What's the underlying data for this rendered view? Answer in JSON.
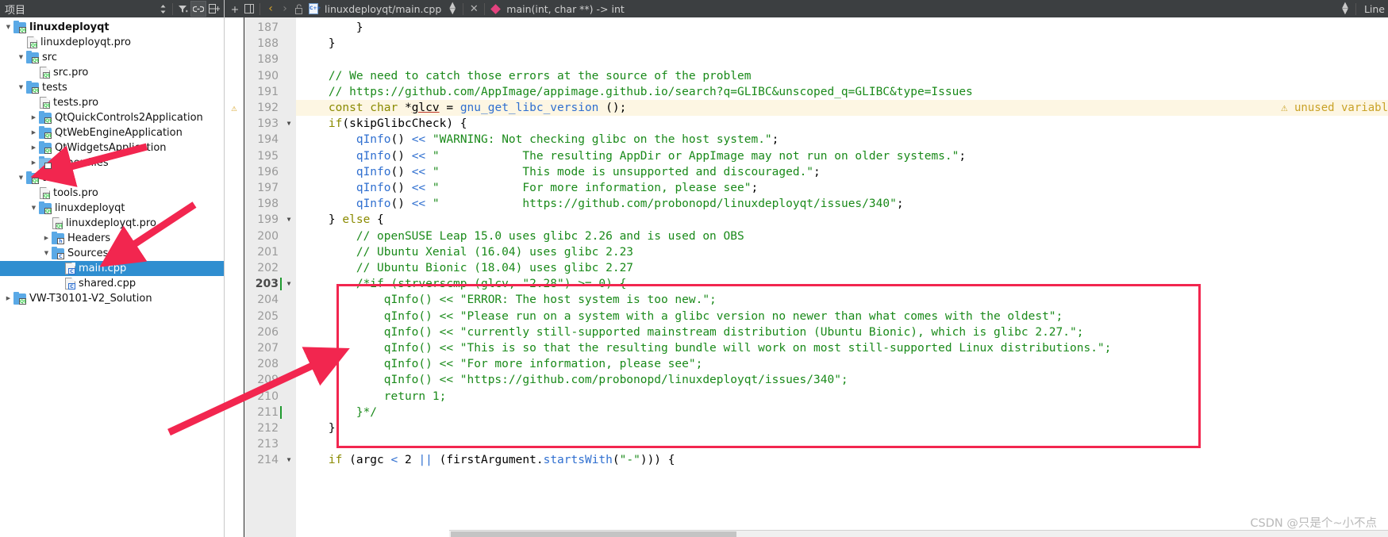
{
  "sidebar": {
    "title": "项目",
    "header_icons": [
      "sort-icon",
      "filter-icon",
      "link-icon",
      "split-icon"
    ],
    "tree": [
      {
        "depth": 0,
        "arrow": "down",
        "icon": "folder-qt",
        "label": "linuxdeployqt",
        "bold": true,
        "selected": false
      },
      {
        "depth": 1,
        "arrow": "none",
        "icon": "file-pro",
        "label": "linuxdeployqt.pro",
        "bold": false,
        "selected": false
      },
      {
        "depth": 1,
        "arrow": "down",
        "icon": "folder-qt",
        "label": "src",
        "bold": false,
        "selected": false
      },
      {
        "depth": 2,
        "arrow": "none",
        "icon": "file-pro",
        "label": "src.pro",
        "bold": false,
        "selected": false
      },
      {
        "depth": 1,
        "arrow": "down",
        "icon": "folder-qt",
        "label": "tests",
        "bold": false,
        "selected": false
      },
      {
        "depth": 2,
        "arrow": "none",
        "icon": "file-pro",
        "label": "tests.pro",
        "bold": false,
        "selected": false
      },
      {
        "depth": 2,
        "arrow": "right",
        "icon": "folder-qt",
        "label": "QtQuickControls2Application",
        "bold": false,
        "selected": false
      },
      {
        "depth": 2,
        "arrow": "right",
        "icon": "folder-qt",
        "label": "QtWebEngineApplication",
        "bold": false,
        "selected": false
      },
      {
        "depth": 2,
        "arrow": "right",
        "icon": "folder-qt",
        "label": "QtWidgetsApplication",
        "bold": false,
        "selected": false
      },
      {
        "depth": 2,
        "arrow": "right",
        "icon": "folder-other",
        "label": "Other files",
        "bold": false,
        "selected": false
      },
      {
        "depth": 1,
        "arrow": "down",
        "icon": "folder-qt",
        "label": "tools",
        "bold": false,
        "selected": false
      },
      {
        "depth": 2,
        "arrow": "none",
        "icon": "file-pro",
        "label": "tools.pro",
        "bold": false,
        "selected": false
      },
      {
        "depth": 2,
        "arrow": "down",
        "icon": "folder-qt",
        "label": "linuxdeployqt",
        "bold": false,
        "selected": false
      },
      {
        "depth": 3,
        "arrow": "none",
        "icon": "file-pro",
        "label": "linuxdeployqt.pro",
        "bold": false,
        "selected": false
      },
      {
        "depth": 3,
        "arrow": "right",
        "icon": "folder-h",
        "label": "Headers",
        "bold": false,
        "selected": false
      },
      {
        "depth": 3,
        "arrow": "down",
        "icon": "folder-cpp",
        "label": "Sources",
        "bold": false,
        "selected": false
      },
      {
        "depth": 4,
        "arrow": "none",
        "icon": "file-cpp",
        "label": "main.cpp",
        "bold": false,
        "selected": true
      },
      {
        "depth": 4,
        "arrow": "none",
        "icon": "file-cpp",
        "label": "shared.cpp",
        "bold": false,
        "selected": false
      },
      {
        "depth": 0,
        "arrow": "right",
        "icon": "folder-qt",
        "label": "VW-T30101-V2_Solution",
        "bold": false,
        "selected": false
      }
    ]
  },
  "tabbar": {
    "back_arrow": "‹",
    "forward_arrow": "›",
    "lock_icon": "unlocked-padlock-icon",
    "file_icon": "cpp-file-icon",
    "file_path": "linuxdeployqt/main.cpp",
    "dropdown_icon": "updown-chevron-icon",
    "close_icon": "close-icon",
    "symbol_icon": "function-diamond-icon",
    "symbol": "main(int, char **) -> int",
    "right_dropdown_icon": "updown-chevron-icon",
    "line_label": "Line"
  },
  "editor": {
    "warning_annotation": "⚠ unused variabl",
    "lines": [
      {
        "num": "187",
        "fold": "",
        "warn": false,
        "cursor": false,
        "tokens": [
          {
            "t": "        }",
            "c": "pl"
          }
        ]
      },
      {
        "num": "188",
        "fold": "",
        "warn": false,
        "cursor": false,
        "tokens": [
          {
            "t": "    }",
            "c": "pl"
          }
        ]
      },
      {
        "num": "189",
        "fold": "",
        "warn": false,
        "cursor": false,
        "tokens": [
          {
            "t": "",
            "c": "pl"
          }
        ]
      },
      {
        "num": "190",
        "fold": "",
        "warn": false,
        "cursor": false,
        "tokens": [
          {
            "t": "    // We need to catch those errors at the source of the problem",
            "c": "cm"
          }
        ]
      },
      {
        "num": "191",
        "fold": "",
        "warn": false,
        "cursor": false,
        "tokens": [
          {
            "t": "    // https://github.com/AppImage/appimage.github.io/search?q=GLIBC&unscoped_q=GLIBC&type=Issues",
            "c": "cm"
          }
        ]
      },
      {
        "num": "192",
        "fold": "",
        "warn": true,
        "cursor": false,
        "highlight": true,
        "tokens": [
          {
            "t": "    ",
            "c": "pl"
          },
          {
            "t": "const char ",
            "c": "kw"
          },
          {
            "t": "*",
            "c": "pl"
          },
          {
            "t": "glcv",
            "c": "err"
          },
          {
            "t": " = ",
            "c": "pl"
          },
          {
            "t": "gnu_get_libc_version",
            "c": "fn"
          },
          {
            "t": " ();",
            "c": "pl"
          }
        ]
      },
      {
        "num": "193",
        "fold": "down",
        "warn": false,
        "cursor": false,
        "tokens": [
          {
            "t": "    ",
            "c": "pl"
          },
          {
            "t": "if",
            "c": "kw"
          },
          {
            "t": "(skipGlibcCheck) {",
            "c": "pl"
          }
        ]
      },
      {
        "num": "194",
        "fold": "",
        "warn": false,
        "cursor": false,
        "tokens": [
          {
            "t": "        ",
            "c": "pl"
          },
          {
            "t": "qInfo",
            "c": "fn"
          },
          {
            "t": "() ",
            "c": "pl"
          },
          {
            "t": "<<",
            "c": "fn"
          },
          {
            "t": " ",
            "c": "pl"
          },
          {
            "t": "\"WARNING: Not checking glibc on the host system.\"",
            "c": "str"
          },
          {
            "t": ";",
            "c": "pl"
          }
        ]
      },
      {
        "num": "195",
        "fold": "",
        "warn": false,
        "cursor": false,
        "tokens": [
          {
            "t": "        ",
            "c": "pl"
          },
          {
            "t": "qInfo",
            "c": "fn"
          },
          {
            "t": "() ",
            "c": "pl"
          },
          {
            "t": "<<",
            "c": "fn"
          },
          {
            "t": " ",
            "c": "pl"
          },
          {
            "t": "\"            The resulting AppDir or AppImage may not run on older systems.\"",
            "c": "str"
          },
          {
            "t": ";",
            "c": "pl"
          }
        ]
      },
      {
        "num": "196",
        "fold": "",
        "warn": false,
        "cursor": false,
        "tokens": [
          {
            "t": "        ",
            "c": "pl"
          },
          {
            "t": "qInfo",
            "c": "fn"
          },
          {
            "t": "() ",
            "c": "pl"
          },
          {
            "t": "<<",
            "c": "fn"
          },
          {
            "t": " ",
            "c": "pl"
          },
          {
            "t": "\"            This mode is unsupported and discouraged.\"",
            "c": "str"
          },
          {
            "t": ";",
            "c": "pl"
          }
        ]
      },
      {
        "num": "197",
        "fold": "",
        "warn": false,
        "cursor": false,
        "tokens": [
          {
            "t": "        ",
            "c": "pl"
          },
          {
            "t": "qInfo",
            "c": "fn"
          },
          {
            "t": "() ",
            "c": "pl"
          },
          {
            "t": "<<",
            "c": "fn"
          },
          {
            "t": " ",
            "c": "pl"
          },
          {
            "t": "\"            For more information, please see\"",
            "c": "str"
          },
          {
            "t": ";",
            "c": "pl"
          }
        ]
      },
      {
        "num": "198",
        "fold": "",
        "warn": false,
        "cursor": false,
        "tokens": [
          {
            "t": "        ",
            "c": "pl"
          },
          {
            "t": "qInfo",
            "c": "fn"
          },
          {
            "t": "() ",
            "c": "pl"
          },
          {
            "t": "<<",
            "c": "fn"
          },
          {
            "t": " ",
            "c": "pl"
          },
          {
            "t": "\"            https://github.com/probonopd/linuxdeployqt/issues/340\"",
            "c": "str"
          },
          {
            "t": ";",
            "c": "pl"
          }
        ]
      },
      {
        "num": "199",
        "fold": "down",
        "warn": false,
        "cursor": false,
        "tokens": [
          {
            "t": "    } ",
            "c": "pl"
          },
          {
            "t": "else",
            "c": "kw"
          },
          {
            "t": " {",
            "c": "pl"
          }
        ]
      },
      {
        "num": "200",
        "fold": "",
        "warn": false,
        "cursor": false,
        "tokens": [
          {
            "t": "        // openSUSE Leap 15.0 uses glibc 2.26 and is used on OBS",
            "c": "cm"
          }
        ]
      },
      {
        "num": "201",
        "fold": "",
        "warn": false,
        "cursor": false,
        "tokens": [
          {
            "t": "        // Ubuntu Xenial (16.04) uses glibc 2.23",
            "c": "cm"
          }
        ]
      },
      {
        "num": "202",
        "fold": "",
        "warn": false,
        "cursor": false,
        "tokens": [
          {
            "t": "        // Ubuntu Bionic (18.04) uses glibc 2.27",
            "c": "cm"
          }
        ]
      },
      {
        "num": "203",
        "fold": "down",
        "warn": false,
        "cursor": true,
        "current": true,
        "tokens": [
          {
            "t": "        /*if (strverscmp (glcv, \"2.28\") >= 0) {",
            "c": "cm"
          }
        ]
      },
      {
        "num": "204",
        "fold": "",
        "warn": false,
        "cursor": false,
        "tokens": [
          {
            "t": "            qInfo() << \"ERROR: The host system is too new.\";",
            "c": "cm"
          }
        ]
      },
      {
        "num": "205",
        "fold": "",
        "warn": false,
        "cursor": false,
        "tokens": [
          {
            "t": "            qInfo() << \"Please run on a system with a glibc version no newer than what comes with the oldest\";",
            "c": "cm"
          }
        ]
      },
      {
        "num": "206",
        "fold": "",
        "warn": false,
        "cursor": false,
        "tokens": [
          {
            "t": "            qInfo() << \"currently still-supported mainstream distribution (Ubuntu Bionic), which is glibc 2.27.\";",
            "c": "cm"
          }
        ]
      },
      {
        "num": "207",
        "fold": "",
        "warn": false,
        "cursor": false,
        "tokens": [
          {
            "t": "            qInfo() << \"This is so that the resulting bundle will work on most still-supported Linux distributions.\";",
            "c": "cm"
          }
        ]
      },
      {
        "num": "208",
        "fold": "",
        "warn": false,
        "cursor": false,
        "tokens": [
          {
            "t": "            qInfo() << \"For more information, please see\";",
            "c": "cm"
          }
        ]
      },
      {
        "num": "209",
        "fold": "",
        "warn": false,
        "cursor": false,
        "tokens": [
          {
            "t": "            qInfo() << \"https://github.com/probonopd/linuxdeployqt/issues/340\";",
            "c": "cm"
          }
        ]
      },
      {
        "num": "210",
        "fold": "",
        "warn": false,
        "cursor": false,
        "tokens": [
          {
            "t": "            return 1;",
            "c": "cm"
          }
        ]
      },
      {
        "num": "211",
        "fold": "",
        "warn": false,
        "cursor": true,
        "tokens": [
          {
            "t": "        }*/",
            "c": "cm"
          }
        ]
      },
      {
        "num": "212",
        "fold": "",
        "warn": false,
        "cursor": false,
        "tokens": [
          {
            "t": "    }",
            "c": "pl"
          }
        ]
      },
      {
        "num": "213",
        "fold": "",
        "warn": false,
        "cursor": false,
        "tokens": [
          {
            "t": "",
            "c": "pl"
          }
        ]
      },
      {
        "num": "214",
        "fold": "down",
        "warn": false,
        "cursor": false,
        "tokens": [
          {
            "t": "    ",
            "c": "pl"
          },
          {
            "t": "if",
            "c": "kw"
          },
          {
            "t": " (argc ",
            "c": "pl"
          },
          {
            "t": "<",
            "c": "fn"
          },
          {
            "t": " ",
            "c": "pl"
          },
          {
            "t": "2",
            "c": "pl"
          },
          {
            "t": " ",
            "c": "pl"
          },
          {
            "t": "||",
            "c": "fn"
          },
          {
            "t": " (firstArgument.",
            "c": "pl"
          },
          {
            "t": "startsWith",
            "c": "fn"
          },
          {
            "t": "(",
            "c": "pl"
          },
          {
            "t": "\"-\"",
            "c": "str"
          },
          {
            "t": "))) {",
            "c": "pl"
          }
        ]
      }
    ]
  },
  "watermark": "CSDN @只是个~小不点",
  "colors": {
    "selection": "#2f8ed0",
    "comment": "#1a8a1a",
    "keyword": "#8a8a00",
    "function": "#2f6fd0",
    "annotation_box": "#f2264f",
    "arrow": "#f2264f",
    "warning": "#c9a227",
    "chrome": "#3c3f41"
  }
}
